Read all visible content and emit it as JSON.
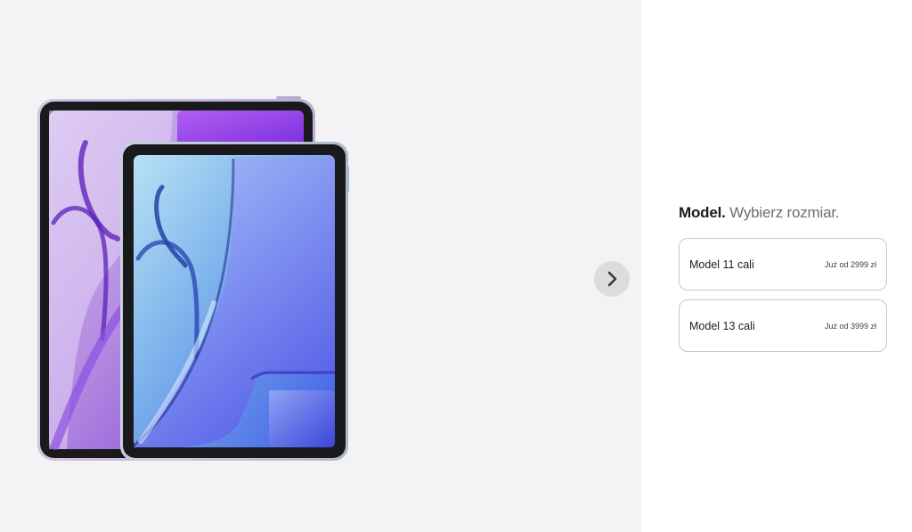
{
  "gallery": {
    "image_alt": "iPad Air 13 i iPad Air 11",
    "next_label": "Next"
  },
  "config": {
    "heading_strong": "Model.",
    "heading_muted": " Wybierz rozmiar.",
    "options": [
      {
        "name": "Model 11 cali",
        "price": "Już od 2999 zł"
      },
      {
        "name": "Model 13 cali",
        "price": "Już od 3999 zł"
      }
    ]
  },
  "colors": {
    "gallery_bg": "#f3f3f5",
    "large_ipad_accent": "#a060e8",
    "small_ipad_accent": "#5a7ef0",
    "next_button_bg": "#dcdcdf"
  }
}
